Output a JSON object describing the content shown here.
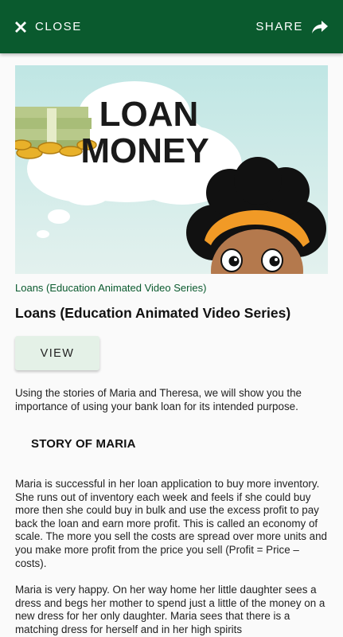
{
  "header": {
    "close_label": "CLOSE",
    "share_label": "SHARE"
  },
  "hero": {
    "image_text_line1": "LOAN",
    "image_text_line2": "MONEY"
  },
  "content": {
    "category": "Loans (Education Animated Video Series)",
    "title": "Loans (Education Animated Video Series)",
    "view_label": "VIEW",
    "intro": "Using the stories of Maria and Theresa, we will show you the importance of using your bank loan for its intended purpose.",
    "section_heading": "STORY OF MARIA",
    "paragraph1": "Maria is successful in her loan application to buy more inventory. She runs out of inventory each week and feels if she could buy more then she could buy in bulk and use the excess profit to pay back the loan and earn more profit. This is called an economy of scale. The more you sell the costs are spread over more units and you make more profit from the price you sell (Profit = Price – costs).",
    "paragraph2": "Maria is very happy. On her way home her little daughter sees a dress and begs her mother to spend just a little of the money on a new dress for her only daughter. Maria sees that there is a matching dress for herself and in her high spirits"
  },
  "colors": {
    "header_bg": "#0a5a2e",
    "accent": "#0a5a2e",
    "button_bg": "#e4f1e7"
  }
}
